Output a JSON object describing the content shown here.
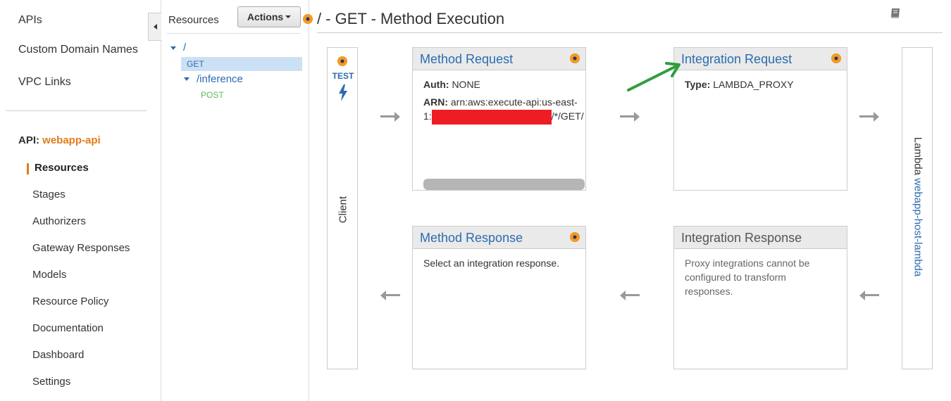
{
  "left_nav": {
    "items": [
      {
        "label": "APIs"
      },
      {
        "label": "Custom Domain Names"
      },
      {
        "label": "VPC Links"
      }
    ],
    "api_prefix": "API:",
    "api_name": "webapp-api",
    "sub_items": [
      {
        "label": "Resources",
        "active": true
      },
      {
        "label": "Stages"
      },
      {
        "label": "Authorizers"
      },
      {
        "label": "Gateway Responses"
      },
      {
        "label": "Models"
      },
      {
        "label": "Resource Policy"
      },
      {
        "label": "Documentation"
      },
      {
        "label": "Dashboard"
      },
      {
        "label": "Settings"
      }
    ]
  },
  "resources": {
    "title": "Resources",
    "actions_label": "Actions",
    "tree": {
      "root": "/",
      "root_method": "GET",
      "child": "/inference",
      "child_method": "POST"
    }
  },
  "main": {
    "title": "/ - GET - Method Execution",
    "client_label": "Client",
    "test_label": "TEST",
    "lambda_prefix": "Lambda",
    "lambda_function": "webapp-host-lambda",
    "method_request": {
      "title": "Method Request",
      "auth_key": "Auth:",
      "auth_value": "NONE",
      "arn_key": "ARN:",
      "arn_value_line1": "arn:aws:execute-api:us-east-",
      "arn_value_line2_prefix": "1:",
      "arn_value_line2_suffix": "/*/GET/"
    },
    "integration_request": {
      "title": "Integration Request",
      "type_key": "Type:",
      "type_value": "LAMBDA_PROXY"
    },
    "method_response": {
      "title": "Method Response",
      "body": "Select an integration response."
    },
    "integration_response": {
      "title": "Integration Response",
      "body": "Proxy integrations cannot be configured to transform responses."
    }
  },
  "colors": {
    "accent_orange": "#e07b1c",
    "link_blue": "#2b6cb0",
    "post_green": "#5cb85c",
    "redaction": "#ee1c24",
    "annotation_arrow": "#2e9e3e"
  }
}
